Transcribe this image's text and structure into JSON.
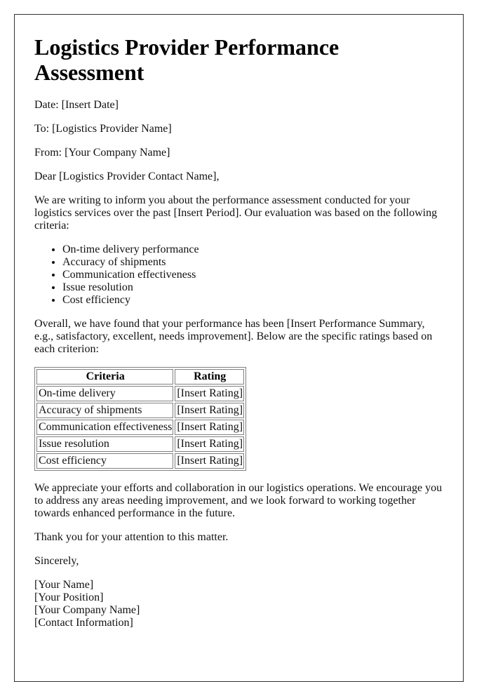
{
  "document": {
    "title": "Logistics Provider Performance Assessment",
    "date_line": "Date: [Insert Date]",
    "to_line": "To: [Logistics Provider Name]",
    "from_line": "From: [Your Company Name]",
    "salutation": "Dear [Logistics Provider Contact Name],",
    "intro_paragraph": "We are writing to inform you about the performance assessment conducted for your logistics services over the past [Insert Period]. Our evaluation was based on the following criteria:",
    "criteria_list": [
      "On-time delivery performance",
      "Accuracy of shipments",
      "Communication effectiveness",
      "Issue resolution",
      "Cost efficiency"
    ],
    "summary_paragraph": "Overall, we have found that your performance has been [Insert Performance Summary, e.g., satisfactory, excellent, needs improvement]. Below are the specific ratings based on each criterion:",
    "ratings_table": {
      "headers": [
        "Criteria",
        "Rating"
      ],
      "rows": [
        {
          "criteria": "On-time delivery",
          "rating": "[Insert Rating]"
        },
        {
          "criteria": "Accuracy of shipments",
          "rating": "[Insert Rating]"
        },
        {
          "criteria": "Communication effectiveness",
          "rating": "[Insert Rating]"
        },
        {
          "criteria": "Issue resolution",
          "rating": "[Insert Rating]"
        },
        {
          "criteria": "Cost efficiency",
          "rating": "[Insert Rating]"
        }
      ]
    },
    "closing_paragraph": "We appreciate your efforts and collaboration in our logistics operations. We encourage you to address any areas needing improvement, and we look forward to working together towards enhanced performance in the future.",
    "thanks_line": "Thank you for your attention to this matter.",
    "sign_off": "Sincerely,",
    "signature": {
      "name": "[Your Name]",
      "position": "[Your Position]",
      "company": "[Your Company Name]",
      "contact": "[Contact Information]"
    }
  }
}
